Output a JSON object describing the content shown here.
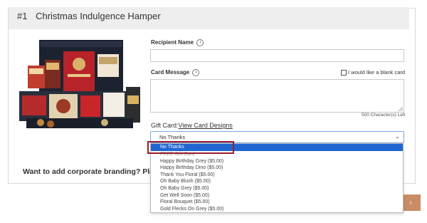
{
  "item": {
    "number": "#1",
    "title": "Christmas Indulgence Hamper"
  },
  "form": {
    "recipient_label": "Recipient Name",
    "message_label": "Card Message",
    "blank_card_label": "I would like a blank card",
    "char_counter": "500 Character(s) Left",
    "giftcard_label": "Gift Card:",
    "giftcard_link": "View Card Designs",
    "selected_option": "No Thanks"
  },
  "dropdown": {
    "options": [
      "No Thanks",
      "FREE Gift Card",
      "Happy Birthday Grey ($5.00)",
      "Happy Birthday Dino ($5.00)",
      "Thank You Floral ($5.00)",
      "Oh Baby Blush ($5.00)",
      "Oh Baby Grey ($5.00)",
      "Get Well Soon ($5.00)",
      "Floral Bouquet ($5.00)",
      "Gold Flecks On Grey ($5.00)"
    ]
  },
  "branding_text": "Want to add corporate branding? Ple",
  "icons": {
    "info": "info-icon",
    "chevron": "chevron-down-icon"
  },
  "colors": {
    "selected_bg": "#1f66d1",
    "highlight_border": "#9b1c2c",
    "accent_button": "#c98d66"
  }
}
